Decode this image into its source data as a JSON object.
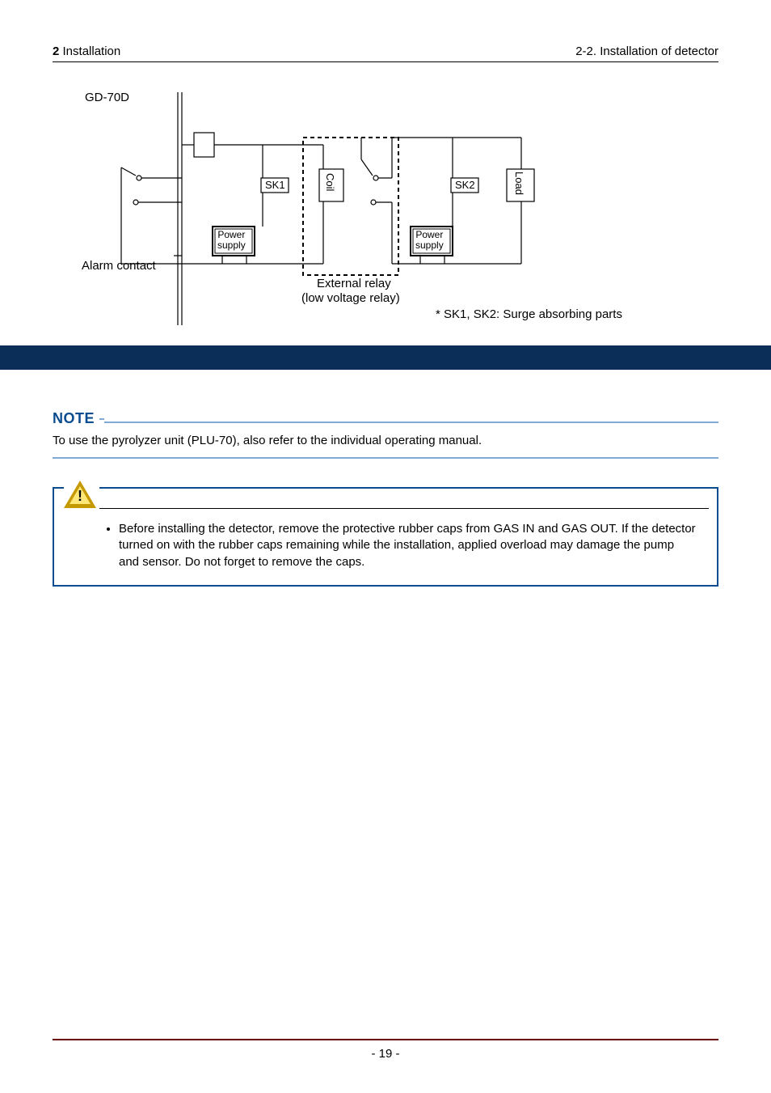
{
  "header": {
    "chapter_no": "2",
    "chapter_title": "Installation",
    "section_label": "2-2. Installation of detector"
  },
  "diagram": {
    "device_label": "GD-70D",
    "alarm_contact": "Alarm contact",
    "sk1": "SK1",
    "sk2": "SK2",
    "coil": "Coil",
    "load": "Load",
    "power_supply_1": "Power\nsupply",
    "power_supply_2": "Power\nsupply",
    "external_relay_line1": "External relay",
    "external_relay_line2": "(low voltage relay)",
    "footnote": "* SK1, SK2: Surge absorbing parts"
  },
  "note": {
    "heading": "NOTE",
    "text": "To use the pyrolyzer unit (PLU-70), also refer to the individual operating manual."
  },
  "caution": {
    "bullet": "Before installing the detector, remove the protective rubber caps from GAS IN and GAS OUT. If the detector turned on with the rubber caps remaining while the installation, applied overload may damage the pump and sensor. Do not forget to remove the caps."
  },
  "footer": {
    "page_number": "- 19 -"
  }
}
